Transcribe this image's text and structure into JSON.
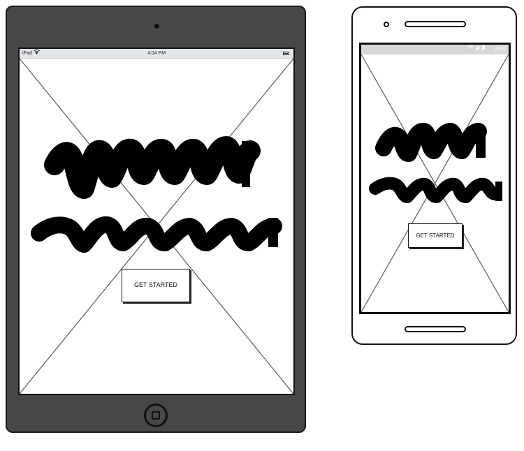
{
  "ipad": {
    "status_bar": {
      "carrier": "iPad",
      "wifi_icon": "wifi-icon",
      "time": "4:04 PM",
      "battery_icon": "battery-icon"
    },
    "cta_label": "GET STARTED"
  },
  "android": {
    "status_bar": {
      "icons": "signal-wifi-battery-icons",
      "time": "10:05"
    },
    "cta_label": "GET STARTED"
  },
  "colors": {
    "device_body": "#474747",
    "outline": "#111111",
    "ios_status_bg": "#e3e6e9",
    "android_status_bg": "#d7d7d7"
  }
}
